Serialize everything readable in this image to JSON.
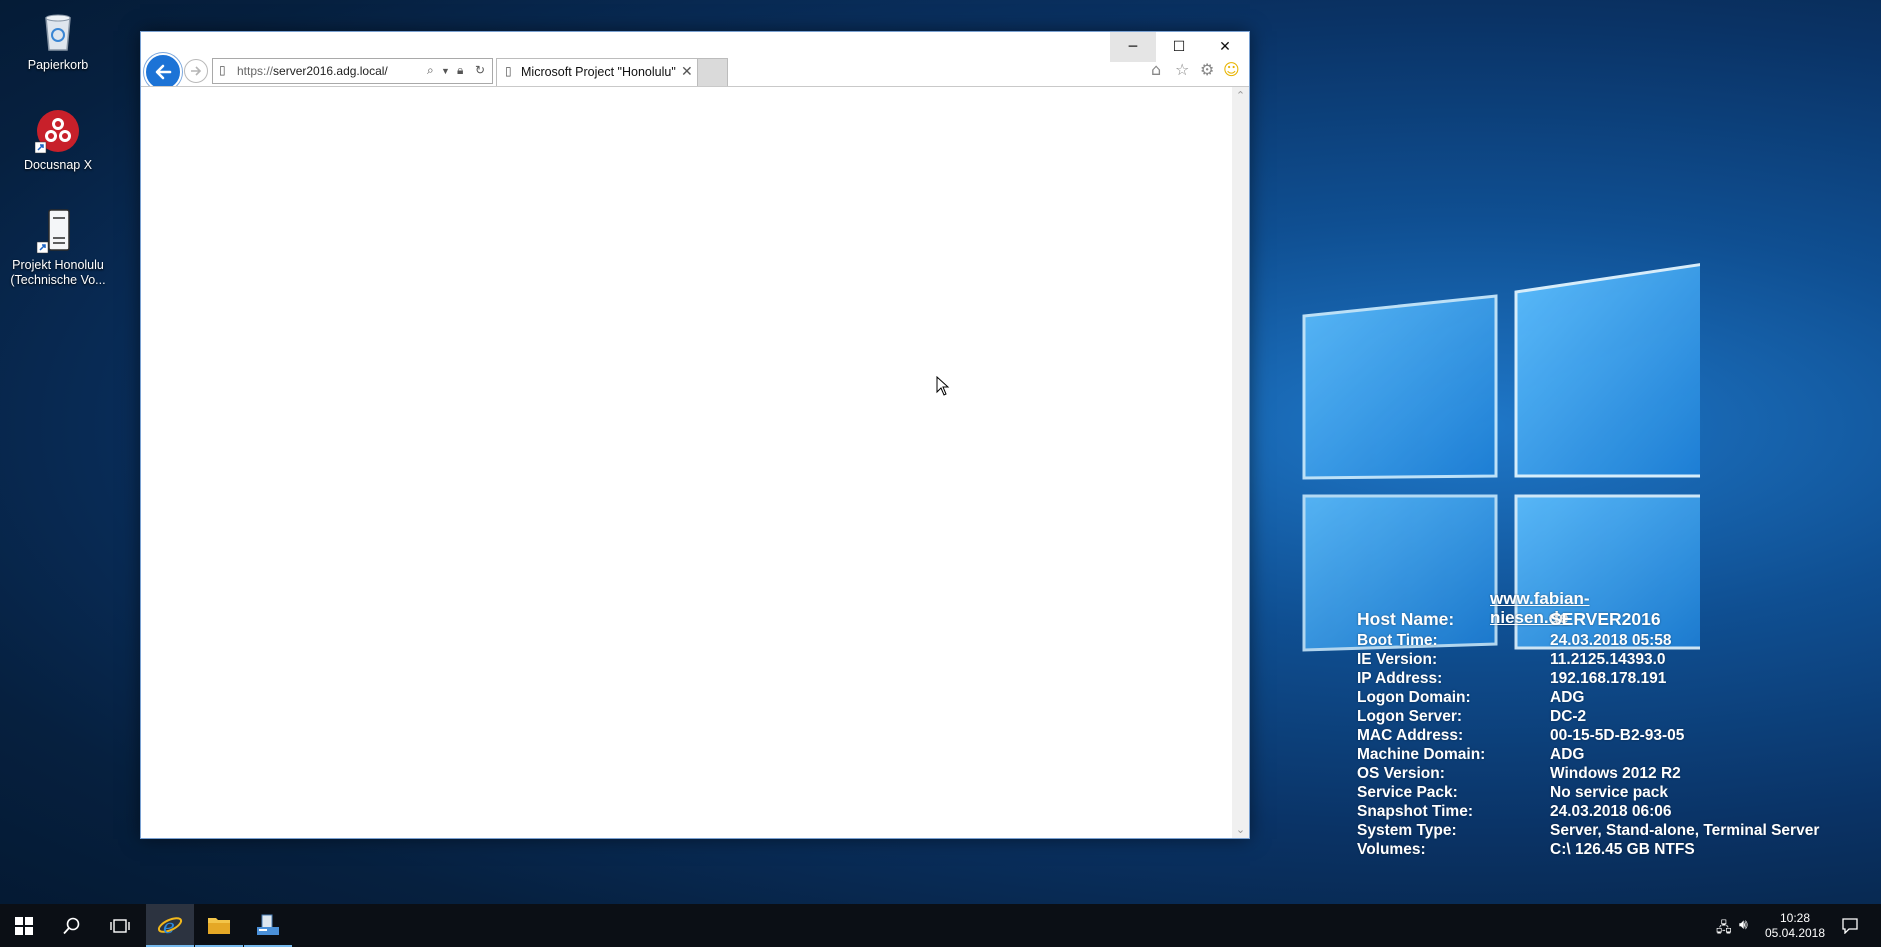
{
  "desktop": {
    "icons": [
      {
        "label_lines": [
          "Papierkorb"
        ]
      },
      {
        "label_lines": [
          "Docusnap X"
        ]
      },
      {
        "label_lines": [
          "Projekt Honolulu",
          "(Technische Vo..."
        ]
      }
    ]
  },
  "browser": {
    "address": "https://server2016.adg.local/",
    "address_prefix": "https://",
    "address_host": "server2016.adg.local/",
    "tab_title": "Microsoft Project \"Honolulu\"",
    "tab_close": "✕",
    "btn_min": "─",
    "btn_max": "☐",
    "btn_close": "✕"
  },
  "bginfo": {
    "url": "www.fabian-niesen.de",
    "rows": [
      {
        "key": "Host Name:",
        "value": "SERVER2016"
      },
      {
        "key": "Boot Time:",
        "value": "24.03.2018 05:58"
      },
      {
        "key": "IE Version:",
        "value": "11.2125.14393.0"
      },
      {
        "key": "IP Address:",
        "value": "192.168.178.191"
      },
      {
        "key": "Logon Domain:",
        "value": "ADG"
      },
      {
        "key": "Logon Server:",
        "value": "DC-2"
      },
      {
        "key": "MAC Address:",
        "value": "00-15-5D-B2-93-05"
      },
      {
        "key": "Machine Domain:",
        "value": "ADG"
      },
      {
        "key": "OS Version:",
        "value": "Windows 2012 R2"
      },
      {
        "key": "Service Pack:",
        "value": "No service pack"
      },
      {
        "key": "Snapshot Time:",
        "value": "24.03.2018 06:06"
      },
      {
        "key": "System Type:",
        "value": "Server, Stand-alone, Terminal Server"
      },
      {
        "key": "Volumes:",
        "value": "C:\\ 126.45 GB NTFS"
      }
    ]
  },
  "taskbar": {
    "time": "10:28",
    "date": "05.04.2018",
    "accent": "#76b9ed"
  }
}
